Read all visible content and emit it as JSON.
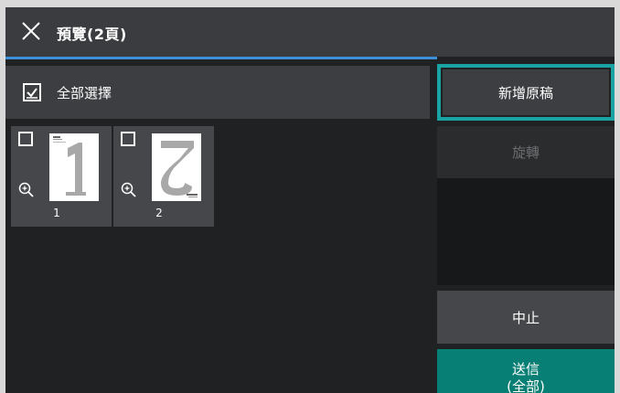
{
  "header": {
    "title": "預覽(2頁)",
    "close_icon": "close-icon"
  },
  "select_all": {
    "label": "全部選擇",
    "icon": "checked-checkbox-icon",
    "checked": true
  },
  "pages": [
    {
      "number": "1",
      "selected": false,
      "zoom_icon": "zoom-in-icon"
    },
    {
      "number": "2",
      "selected": false,
      "zoom_icon": "zoom-in-icon"
    }
  ],
  "actions": {
    "add_original": "新增原稿",
    "rotate": "旋轉",
    "stop": "中止",
    "send_line1": "送信",
    "send_line2": "(全部)"
  },
  "colors": {
    "accent_focus": "#1aa3a3",
    "send_button": "#087f74",
    "header_line": "#3d8fd9",
    "background": "#1f2123"
  }
}
